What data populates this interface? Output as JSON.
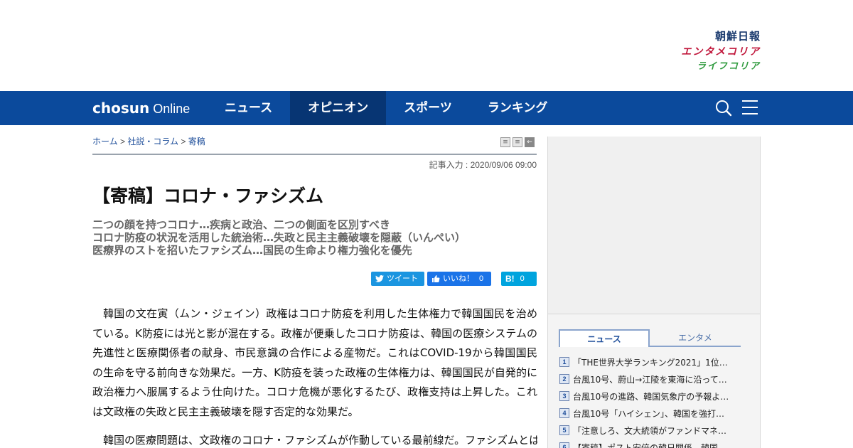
{
  "brand": {
    "chosun": "朝鮮日報",
    "entame": "エンタメコリア",
    "life": "ライフコリア"
  },
  "nav": {
    "logo_bold": "chosun",
    "logo_light": "Online",
    "items": [
      "ニュース",
      "オピニオン",
      "スポーツ",
      "ランキング"
    ],
    "active_index": 1,
    "accent": "#0b4a9c",
    "active_color": "#073573"
  },
  "breadcrumb": {
    "home": "ホーム",
    "section": "社説・コラム",
    "current": "寄稿",
    "sep": ">"
  },
  "article": {
    "date": "記事入力 : 2020/09/06 09:00",
    "headline": "【寄稿】コロナ・ファシズム",
    "subheads": [
      "二つの顔を持つコロナ…疾病と政治、二つの側面を区別すべき",
      "コロナ防疫の状況を活用した統治術…失政と民主主義破壊を隠蔽（いんぺい）",
      "医療界のストを招いたファシズム…国民の生命より権力強化を優先"
    ],
    "paragraphs": [
      "韓国の文在寅（ムン・ジェイン）政権はコロナ防疫を利用した生体権力で韓国国民を治めている。K防疫には光と影が混在する。政権が便乗したコロナ防疫は、韓国の医療システムの先進性と医療関係者の献身、市民意識の合作による産物だ。これはCOVID-19から韓国国民の生命を守る前向きな効果だ。一方、K防疫を装った政権の生体権力は、韓国国民が自発的に政治権力へ服属するよう仕向けた。コロナ危機が悪化するたび、政権支持は上昇した。これは文政権の失政と民主主義破壊を隠す否定的な効果だ。",
      "韓国の医療問題は、文政権のコロナ・ファシズムが作動している最前線だ。ファシズムとは"
    ]
  },
  "social": {
    "tweet": "ツイート",
    "like": "いいね！",
    "like_count": "0",
    "hatena_label": "B!",
    "hatena_count": "0"
  },
  "ranking": {
    "tabs": [
      "ニュース",
      "エンタメ"
    ],
    "active_tab": 0,
    "items": [
      {
        "rank": "1",
        "title": "「THE世界大学ランキング2021」1位…"
      },
      {
        "rank": "2",
        "title": "台風10号、蔚山→江陵を東海に沿って…"
      },
      {
        "rank": "3",
        "title": "台風10号の進路、韓国気象庁の予報よ…"
      },
      {
        "rank": "4",
        "title": "台風10号「ハイシェン」、韓国を強打…"
      },
      {
        "rank": "5",
        "title": "「注意しろ、文大統領がファンドマネ…"
      },
      {
        "rank": "6",
        "title": "【寄稿】ポスト安倍の韓日関係、韓国…"
      }
    ]
  }
}
